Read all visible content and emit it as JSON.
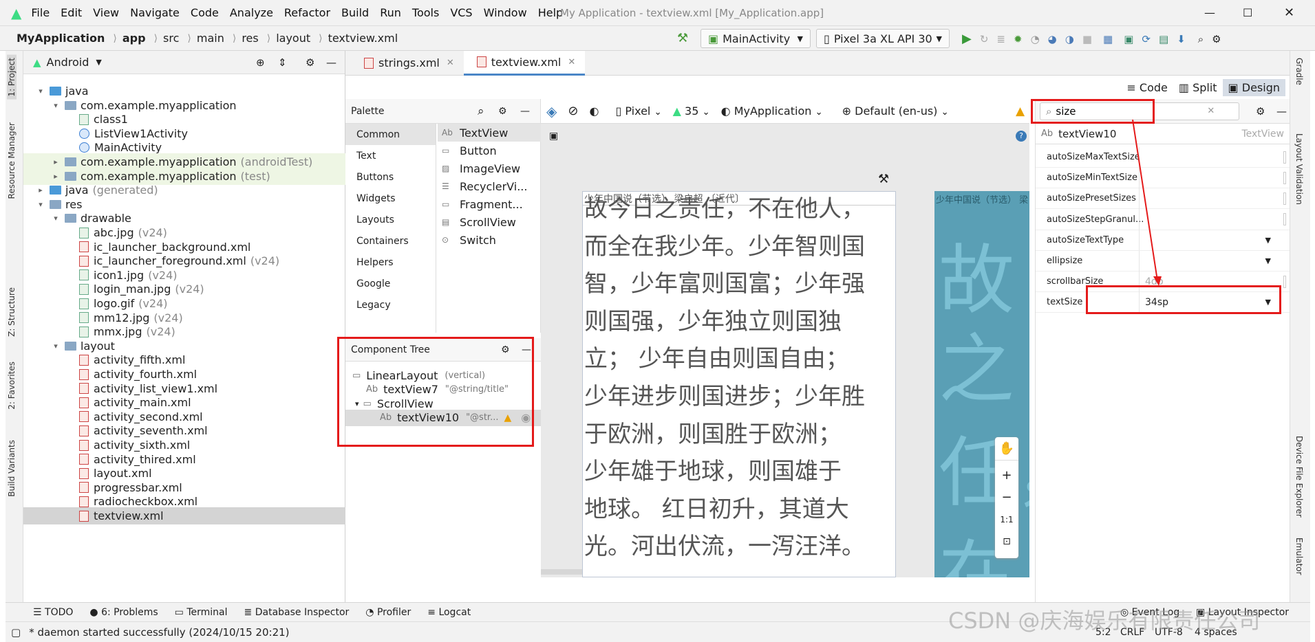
{
  "window": {
    "title": "My Application - textview.xml [My_Application.app]"
  },
  "menu": [
    "File",
    "Edit",
    "View",
    "Navigate",
    "Code",
    "Analyze",
    "Refactor",
    "Build",
    "Run",
    "Tools",
    "VCS",
    "Window",
    "Help"
  ],
  "breadcrumb": [
    "MyApplication",
    "app",
    "src",
    "main",
    "res",
    "layout",
    "textview.xml"
  ],
  "toolbar": {
    "run_config": "MainActivity",
    "device": "Pixel 3a XL API 30"
  },
  "left_strip": [
    "1: Project",
    "Resource Manager",
    "Z: Structure",
    "2: Favorites",
    "Build Variants"
  ],
  "project": {
    "view": "Android",
    "rows": [
      {
        "label": "java",
        "dim": ""
      },
      {
        "label": "com.example.myapplication",
        "dim": ""
      },
      {
        "label": "class1",
        "dim": ""
      },
      {
        "label": "ListView1Activity",
        "dim": ""
      },
      {
        "label": "MainActivity",
        "dim": ""
      },
      {
        "label": "com.example.myapplication",
        "dim": "(androidTest)"
      },
      {
        "label": "com.example.myapplication",
        "dim": "(test)"
      },
      {
        "label": "java",
        "dim": "(generated)"
      },
      {
        "label": "res",
        "dim": ""
      },
      {
        "label": "drawable",
        "dim": ""
      },
      {
        "label": "abc.jpg",
        "dim": "(v24)"
      },
      {
        "label": "ic_launcher_background.xml",
        "dim": ""
      },
      {
        "label": "ic_launcher_foreground.xml",
        "dim": "(v24)"
      },
      {
        "label": "icon1.jpg",
        "dim": "(v24)"
      },
      {
        "label": "login_man.jpg",
        "dim": "(v24)"
      },
      {
        "label": "logo.gif",
        "dim": "(v24)"
      },
      {
        "label": "mm12.jpg",
        "dim": "(v24)"
      },
      {
        "label": "mmx.jpg",
        "dim": "(v24)"
      },
      {
        "label": "layout",
        "dim": ""
      },
      {
        "label": "activity_fifth.xml",
        "dim": ""
      },
      {
        "label": "activity_fourth.xml",
        "dim": ""
      },
      {
        "label": "activity_list_view1.xml",
        "dim": ""
      },
      {
        "label": "activity_main.xml",
        "dim": ""
      },
      {
        "label": "activity_second.xml",
        "dim": ""
      },
      {
        "label": "activity_seventh.xml",
        "dim": ""
      },
      {
        "label": "activity_sixth.xml",
        "dim": ""
      },
      {
        "label": "activity_thired.xml",
        "dim": ""
      },
      {
        "label": "layout.xml",
        "dim": ""
      },
      {
        "label": "progressbar.xml",
        "dim": ""
      },
      {
        "label": "radiocheckbox.xml",
        "dim": ""
      },
      {
        "label": "textview.xml",
        "dim": ""
      }
    ]
  },
  "editor_tabs": [
    "strings.xml",
    "textview.xml"
  ],
  "modes": [
    "Code",
    "Split",
    "Design"
  ],
  "palette": {
    "title": "Palette",
    "categories": [
      "Common",
      "Text",
      "Buttons",
      "Widgets",
      "Layouts",
      "Containers",
      "Helpers",
      "Google",
      "Legacy"
    ],
    "items": [
      "TextView",
      "Button",
      "ImageView",
      "RecyclerVi...",
      "Fragment...",
      "ScrollView",
      "Switch"
    ]
  },
  "component_tree": {
    "title": "Component Tree",
    "nodes": [
      {
        "label": "LinearLayout",
        "hint": "(vertical)"
      },
      {
        "label": "textView7",
        "hint": "\"@string/title\""
      },
      {
        "label": "ScrollView",
        "hint": ""
      },
      {
        "label": "textView10",
        "hint": "\"@str..."
      }
    ]
  },
  "design_bar": {
    "device": "Pixel",
    "api": "35",
    "theme": "MyApplication",
    "locale": "Default (en-us)"
  },
  "preview": {
    "title": "少年中国说（节选） 梁启超 〔近代〕",
    "lines": [
      "故今日之责任，不在他人，",
      "而全在我少年。少年智则国",
      "智，少年富则国富；少年强",
      "则国强，少年独立则国独",
      "立； 少年自由则国自由；",
      "少年进步则国进步；少年胜",
      "于欧洲，则国胜于欧洲；",
      "少年雄于地球，则国雄于",
      "地球。 红日初升，其道大",
      "光。河出伏流，一泻汪洋。"
    ],
    "blueprint_title": "少年中国说（节选） 梁",
    "blueprint_chars": [
      "故",
      "之",
      "任，",
      "在"
    ]
  },
  "zoom": [
    "+",
    "−",
    "1:1"
  ],
  "attributes": {
    "search": "size",
    "component": "textView10",
    "component_type": "TextView",
    "rows": [
      {
        "name": "autoSizeMaxTextSize",
        "value": ""
      },
      {
        "name": "autoSizeMinTextSize",
        "value": ""
      },
      {
        "name": "autoSizePresetSizes",
        "value": ""
      },
      {
        "name": "autoSizeStepGranul...",
        "value": ""
      },
      {
        "name": "autoSizeTextType",
        "value": ""
      },
      {
        "name": "ellipsize",
        "value": ""
      },
      {
        "name": "scrollbarSize",
        "value": "4dp"
      },
      {
        "name": "textSize",
        "value": "34sp"
      }
    ]
  },
  "right_strip": [
    "Gradle",
    "Layout Validation",
    "Device File Explorer",
    "Emulator"
  ],
  "bottom_tabs": [
    "TODO",
    "6: Problems",
    "Terminal",
    "Database Inspector",
    "Profiler",
    "Logcat",
    "Event Log",
    "Layout Inspector"
  ],
  "status": {
    "message": "* daemon started successfully (2024/10/15 20:21)",
    "pos": "5:2",
    "crlf": "CRLF",
    "enc": "UTF-8",
    "indent": "4 spaces"
  },
  "watermark": "CSDN @庆海娱乐有限责任公司"
}
